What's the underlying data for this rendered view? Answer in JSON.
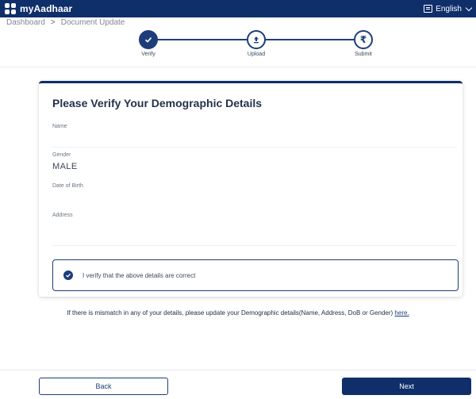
{
  "app": {
    "name": "myAadhaar"
  },
  "language": {
    "selected": "English",
    "icon": "language-icon"
  },
  "breadcrumb": {
    "items": [
      "Dashboard",
      "Document Update"
    ],
    "separator": ">"
  },
  "stepper": {
    "steps": [
      {
        "label": "Verify",
        "icon": "check-icon",
        "state": "complete"
      },
      {
        "label": "Upload",
        "icon": "upload-icon",
        "state": "pending"
      },
      {
        "label": "Submit",
        "icon": "rupee-icon",
        "state": "pending"
      }
    ]
  },
  "form": {
    "title": "Please Verify Your Demographic Details",
    "fields": [
      {
        "label": "Name",
        "value": ""
      },
      {
        "label": "Gender",
        "value": "MALE"
      },
      {
        "label": "Date of Birth",
        "value": ""
      },
      {
        "label": "Address",
        "value": ""
      }
    ],
    "verify_text": "I verify that the above details are correct",
    "verify_checked": true
  },
  "notice": {
    "text": "If there is mismatch in any of your details, please update your Demographic details(Name, Address, DoB or Gender) ",
    "link": "here."
  },
  "footer": {
    "back_label": "Back",
    "next_label": "Next"
  },
  "colors": {
    "brand_dark": "#0f2f6b",
    "accent": "#1d3d7a"
  }
}
